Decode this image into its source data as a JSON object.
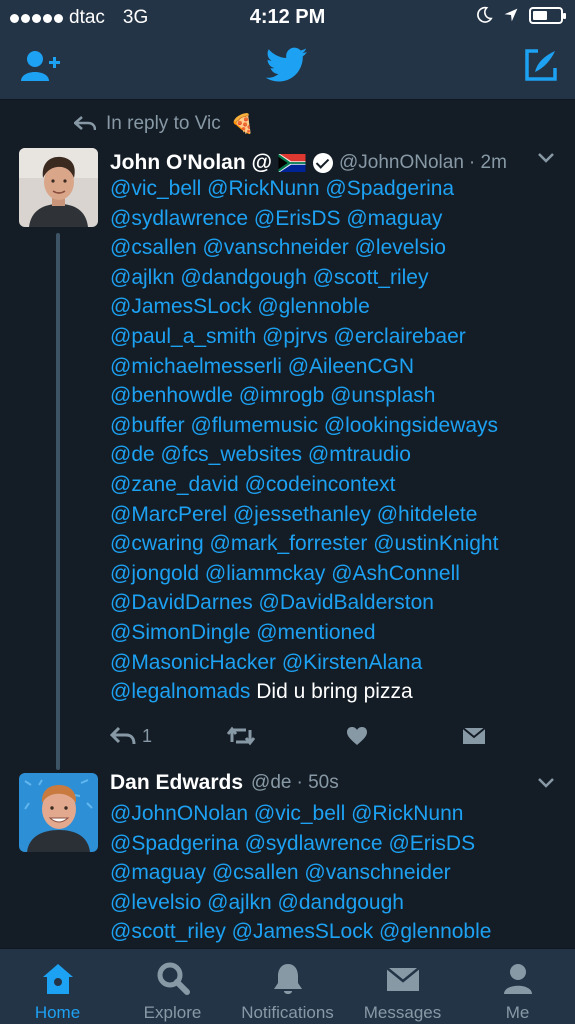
{
  "status_bar": {
    "carrier": "dtac",
    "network": "3G",
    "time": "4:12 PM",
    "battery_level": 0.55
  },
  "nav": {
    "left_icon": "add-user-icon",
    "center_icon": "twitter-bird-icon",
    "right_icon": "compose-icon"
  },
  "reply_context": {
    "text": "In reply to Vic",
    "emoji": "🍕"
  },
  "tweets": [
    {
      "name": "John O'Nolan @",
      "flag_icon": "south-africa-flag-icon",
      "verified": true,
      "handle": "@JohnONolan",
      "time": "· 2m",
      "body_lines": [
        "@vic_bell @RickNunn @Spadgerina",
        "@sydlawrence @ErisDS @maguay",
        "@csallen @vanschneider @levelsio",
        "@ajlkn @dandgough @scott_riley",
        "@JamesSLock @glennoble",
        "@paul_a_smith @pjrvs @erclairebaer",
        "@michaelmesserli @AileenCGN",
        "@benhowdle @imrogb @unsplash",
        "@buffer @flumemusic @lookingsideways",
        "@de @fcs_websites @mtraudio",
        "@zane_david @codeincontext",
        "@MarcPerel @jessethanley @hitdelete",
        "@cwaring @mark_forrester @ustinKnight",
        "@jongold @liammckay @AshConnell",
        "@DavidDarnes @DavidBalderston",
        "@SimonDingle @mentioned",
        "@MasonicHacker @KirstenAlana"
      ],
      "last_line_mention": "@legalnomads",
      "last_line_text": " Did u bring pizza",
      "reply_count": "1"
    },
    {
      "name": "Dan Edwards",
      "handle": "@de",
      "time": "· 50s",
      "body_lines": [
        "@JohnONolan @vic_bell @RickNunn",
        "@Spadgerina @sydlawrence @ErisDS",
        "@maguay @csallen @vanschneider",
        "@levelsio @ajlkn @dandgough",
        "@scott_riley @JamesSLock @glennoble"
      ]
    }
  ],
  "tabs": [
    {
      "label": "Home",
      "icon": "home-icon",
      "active": true
    },
    {
      "label": "Explore",
      "icon": "search-icon",
      "active": false
    },
    {
      "label": "Notifications",
      "icon": "bell-icon",
      "active": false
    },
    {
      "label": "Messages",
      "icon": "envelope-icon",
      "active": false
    },
    {
      "label": "Me",
      "icon": "person-icon",
      "active": false
    }
  ],
  "colors": {
    "background": "#141d26",
    "bar": "#243447",
    "accent": "#1da1f2",
    "muted": "#8899a6"
  }
}
